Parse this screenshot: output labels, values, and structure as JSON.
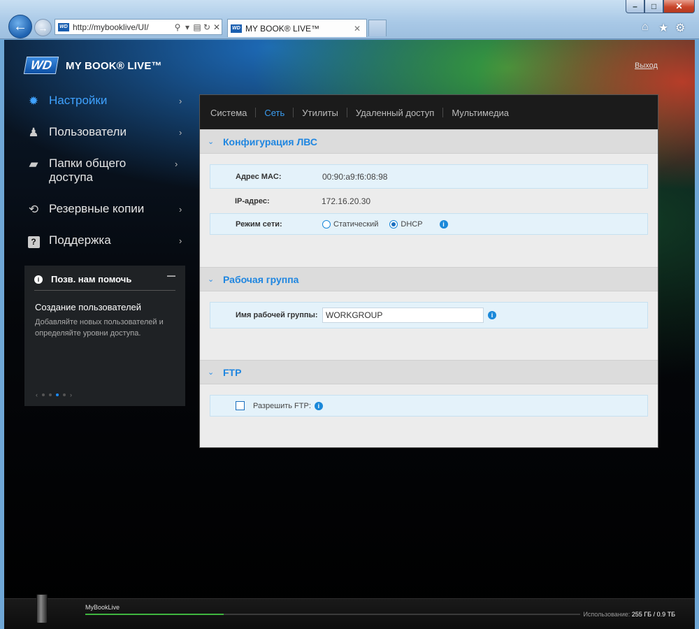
{
  "browser": {
    "address": "http://mybooklive/UI/",
    "tab_title": "MY BOOK® LIVE™",
    "favicon": "WD"
  },
  "header": {
    "logo_text": "WD",
    "product": "MY BOOK® LIVE™",
    "logout": "Выход"
  },
  "sidebar": {
    "items": [
      {
        "label": "Настройки",
        "icon": "gear-icon",
        "active": true
      },
      {
        "label": "Пользователи",
        "icon": "users-icon",
        "active": false
      },
      {
        "label": "Папки общего доступа",
        "icon": "folder-icon",
        "active": false
      },
      {
        "label": "Резервные копии",
        "icon": "history-icon",
        "active": false
      },
      {
        "label": "Поддержка",
        "icon": "help-icon",
        "active": false
      }
    ]
  },
  "help": {
    "title": "Позв. нам помочь",
    "heading": "Создание пользователей",
    "text": "Добавляйте новых пользователей и определяйте уровни доступа.",
    "page": 3,
    "page_count": 4
  },
  "tabs": [
    "Система",
    "Сеть",
    "Утилиты",
    "Удаленный доступ",
    "Мультимедиа"
  ],
  "active_tab": "Сеть",
  "lan": {
    "title": "Конфигурация ЛВС",
    "mac_label": "Адрес MAC:",
    "mac_value": "00:90:a9:f6:08:98",
    "ip_label": "IP-адрес:",
    "ip_value": "172.16.20.30",
    "mode_label": "Режим сети:",
    "mode_static": "Статический",
    "mode_dhcp": "DHCP",
    "mode_selected": "DHCP"
  },
  "workgroup": {
    "title": "Рабочая группа",
    "label": "Имя рабочей группы:",
    "value": "WORKGROUP"
  },
  "ftp": {
    "title": "FTP",
    "label": "Разрешить FTP:",
    "enabled": false
  },
  "footer": {
    "device_name": "MyBookLive",
    "usage_label": "Использование:",
    "usage_value": "255 ГБ / 0.9 ТБ",
    "usage_fraction": 0.28
  },
  "colors": {
    "accent": "#1f86e0",
    "usage_bar": "#3fb53f"
  }
}
